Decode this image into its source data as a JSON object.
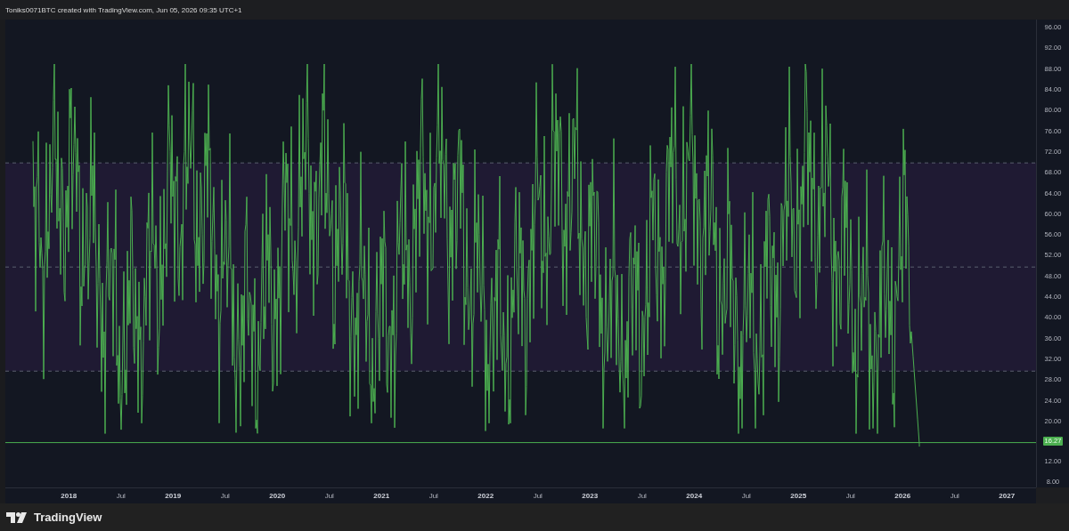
{
  "header": {
    "caption": "Toniks0071BTC created with TradingView.com, Jun 05, 2026 09:35 UTC+1"
  },
  "chart": {
    "price_axis": [
      {
        "label": "96.00",
        "kind": "tick"
      },
      {
        "label": "92.00",
        "kind": "tick"
      },
      {
        "label": "88.00",
        "kind": "tick"
      },
      {
        "label": "84.00",
        "kind": "tick"
      },
      {
        "label": "80.00",
        "kind": "tick"
      },
      {
        "label": "76.00",
        "kind": "tick"
      },
      {
        "label": "72.00",
        "kind": "tick"
      },
      {
        "label": "68.00",
        "kind": "tick"
      },
      {
        "label": "64.00",
        "kind": "tick"
      },
      {
        "label": "60.00",
        "kind": "tick"
      },
      {
        "label": "56.00",
        "kind": "tick"
      },
      {
        "label": "52.00",
        "kind": "tick"
      },
      {
        "label": "48.00",
        "kind": "tick"
      },
      {
        "label": "44.00",
        "kind": "tick"
      },
      {
        "label": "40.00",
        "kind": "tick"
      },
      {
        "label": "36.00",
        "kind": "tick"
      },
      {
        "label": "32.00",
        "kind": "tick"
      },
      {
        "label": "28.00",
        "kind": "tick"
      },
      {
        "label": "24.00",
        "kind": "tick"
      },
      {
        "label": "20.00",
        "kind": "tick"
      },
      {
        "label": "16.27",
        "kind": "current"
      },
      {
        "label": "12.00",
        "kind": "tick"
      },
      {
        "label": "8.00",
        "kind": "tick"
      }
    ],
    "time_axis": [
      {
        "label": "2018",
        "kind": "year"
      },
      {
        "label": "Jul",
        "kind": "month"
      },
      {
        "label": "2019",
        "kind": "year"
      },
      {
        "label": "Jul",
        "kind": "month"
      },
      {
        "label": "2020",
        "kind": "year"
      },
      {
        "label": "Jul",
        "kind": "month"
      },
      {
        "label": "2021",
        "kind": "year"
      },
      {
        "label": "Jul",
        "kind": "month"
      },
      {
        "label": "2022",
        "kind": "year"
      },
      {
        "label": "Jul",
        "kind": "month"
      },
      {
        "label": "2023",
        "kind": "year"
      },
      {
        "label": "Jul",
        "kind": "month"
      },
      {
        "label": "2024",
        "kind": "year"
      },
      {
        "label": "Jul",
        "kind": "month"
      },
      {
        "label": "2025",
        "kind": "year"
      },
      {
        "label": "Jul",
        "kind": "month"
      },
      {
        "label": "2026",
        "kind": "year"
      },
      {
        "label": "Jul",
        "kind": "month"
      },
      {
        "label": "2027",
        "kind": "year"
      }
    ]
  },
  "footer": {
    "brand": "TradingView"
  }
}
